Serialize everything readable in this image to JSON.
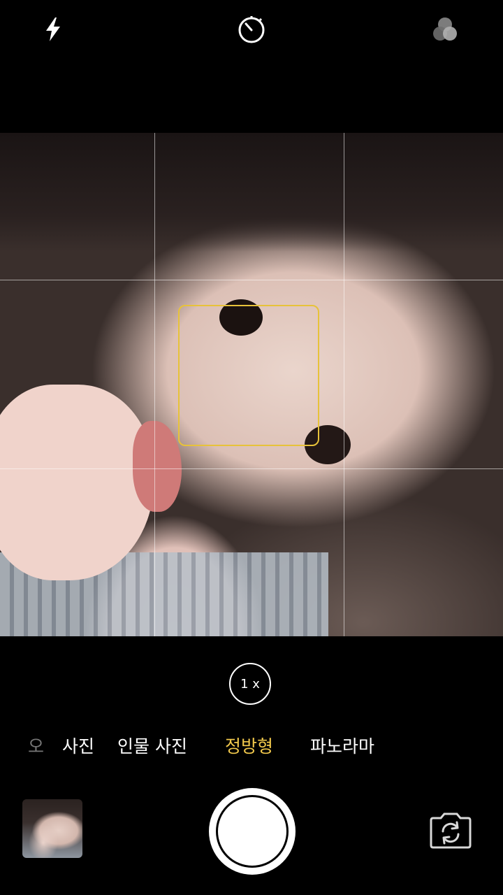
{
  "top_bar": {
    "flash_icon": "flash-icon",
    "timer_icon": "timer-icon",
    "filters_icon": "filters-icon"
  },
  "zoom": {
    "label": "1 x"
  },
  "modes": {
    "items": [
      {
        "label": "오",
        "state": "faded"
      },
      {
        "label": "사진",
        "state": "normal"
      },
      {
        "label": "인물 사진",
        "state": "normal"
      },
      {
        "label": "정방형",
        "state": "selected"
      },
      {
        "label": "파노라마",
        "state": "normal"
      }
    ]
  },
  "controls": {
    "thumbnail_icon": "last-photo-thumbnail",
    "shutter_icon": "shutter-button",
    "switch_icon": "camera-switch-icon"
  },
  "colors": {
    "accent": "#f2c94c",
    "focus_box": "#e7c23a",
    "background": "#000000"
  }
}
